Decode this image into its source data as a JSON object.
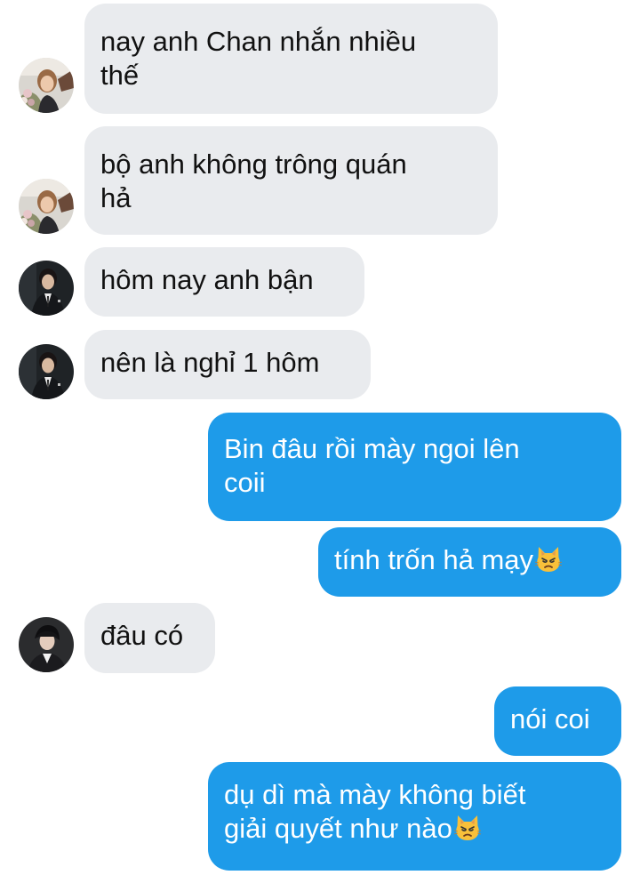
{
  "conversation": {
    "messages": [
      {
        "direction": "incoming",
        "avatar": "avatar-woman-flowers",
        "lines": [
          "nay anh Chan nhắn nhiều",
          "thế"
        ]
      },
      {
        "direction": "incoming",
        "avatar": "avatar-woman-flowers",
        "lines": [
          "bộ anh không trông quán",
          "hả"
        ]
      },
      {
        "direction": "incoming",
        "avatar": "avatar-man-suit",
        "lines": [
          "hôm nay anh bận"
        ]
      },
      {
        "direction": "incoming",
        "avatar": "avatar-man-suit",
        "lines": [
          "nên là nghỉ 1 hôm"
        ]
      },
      {
        "direction": "outgoing",
        "lines": [
          "Bin đâu rồi mày ngoi lên",
          "coii"
        ]
      },
      {
        "direction": "outgoing",
        "lines": [
          "tính trốn hả mạy"
        ],
        "trailing_emoji": "pouting-cat-emoji"
      },
      {
        "direction": "incoming",
        "avatar": "avatar-man-dark",
        "lines": [
          "đâu có"
        ]
      },
      {
        "direction": "outgoing",
        "lines": [
          "nói coi"
        ]
      },
      {
        "direction": "outgoing",
        "lines": [
          "dụ dì mà mày không biết",
          "giải quyết như nào"
        ],
        "trailing_emoji": "pouting-cat-emoji"
      }
    ]
  },
  "colors": {
    "incoming_bubble": "#e9ebee",
    "outgoing_bubble": "#1e9be9",
    "incoming_text": "#111111",
    "outgoing_text": "#ffffff",
    "background": "#ffffff"
  }
}
